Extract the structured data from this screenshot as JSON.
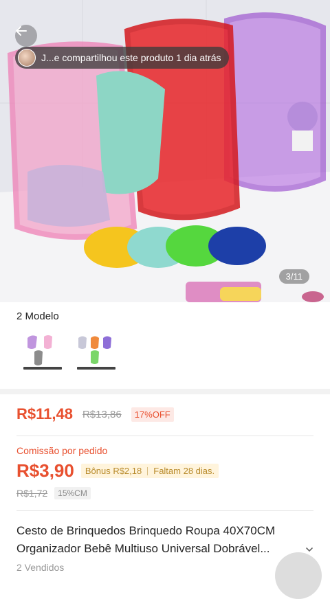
{
  "hero": {
    "share_text": "J...e compartilhou este produto 1 dia atrás",
    "image_counter": "3/11"
  },
  "models": {
    "title": "2 Modelo",
    "variants": [
      {
        "name": "variant-1",
        "colors": [
          "#b07ad6",
          "#f2a9cf",
          "#8c8c8c"
        ]
      },
      {
        "name": "variant-2",
        "colors": [
          "#c8c8d8",
          "#f08a3c",
          "#8e6fd8",
          "#7bd66a"
        ]
      }
    ]
  },
  "price": {
    "current": "R$11,48",
    "original": "R$13,86",
    "discount": "17%OFF"
  },
  "commission": {
    "label": "Comissão por pedido",
    "value": "R$3,90",
    "bonus": "Bônus R$2,18",
    "remaining": "Faltam 28 dias.",
    "old_value": "R$1,72",
    "rate": "15%CM"
  },
  "product": {
    "title_line1": "Cesto de Brinquedos Brinquedo Roupa 40X70CM",
    "title_line2": "Organizador Bebê Multiuso Universal Dobrável...",
    "sold": "2 Vendidos"
  },
  "colors": {
    "accent": "#e8502f",
    "bonus_text": "#b88a2a"
  }
}
